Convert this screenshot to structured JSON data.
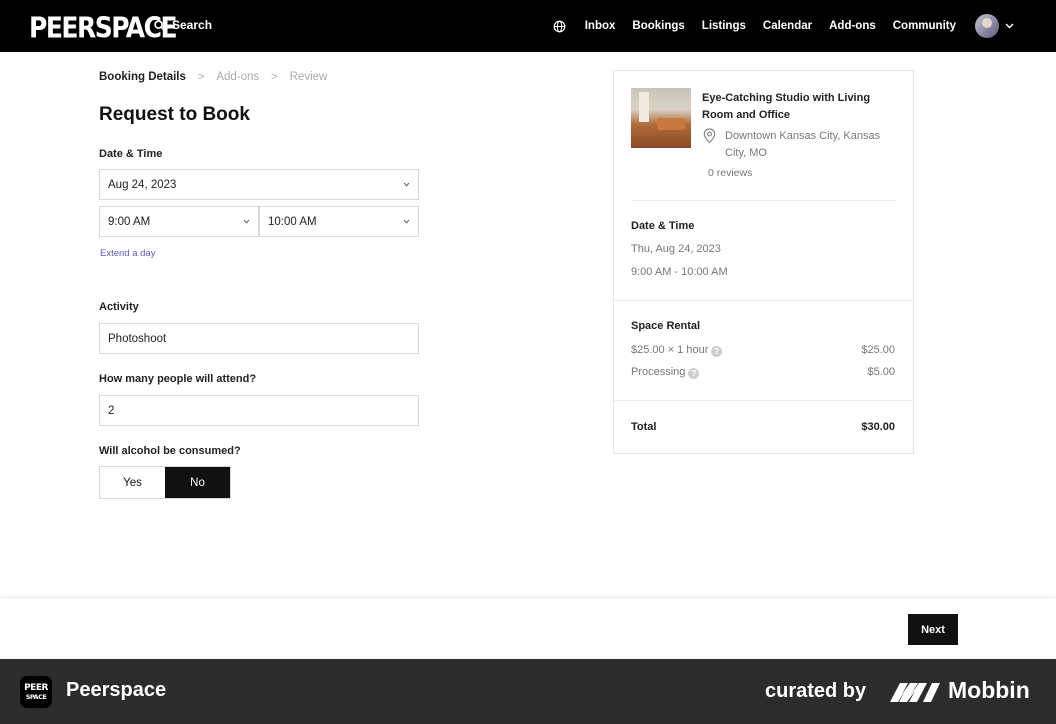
{
  "nav": {
    "logo": "PEERSPACE",
    "search_label": "Search",
    "links": [
      "Inbox",
      "Bookings",
      "Listings",
      "Calendar",
      "Add-ons",
      "Community"
    ]
  },
  "breadcrumb": {
    "steps": [
      "Booking Details",
      "Add-ons",
      "Review"
    ],
    "separator": ">"
  },
  "form": {
    "title": "Request to Book",
    "date_time_label": "Date & Time",
    "date_value": "Aug 24, 2023",
    "start_time": "9:00 AM",
    "end_time": "10:00 AM",
    "extend_link": "Extend a day",
    "activity_label": "Activity",
    "activity_value": "Photoshoot",
    "attendees_label": "How many people will attend?",
    "attendees_value": "2",
    "alcohol_label": "Will alcohol be consumed?",
    "alcohol_yes": "Yes",
    "alcohol_no": "No",
    "alcohol_selected": "No"
  },
  "summary": {
    "listing_title": "Eye-Catching Studio with Living Room and Office",
    "location": "Downtown Kansas City, Kansas City, MO",
    "reviews": "0 reviews",
    "date_time_heading": "Date & Time",
    "date": "Thu, Aug 24, 2023",
    "time_range": "9:00 AM - 10:00 AM",
    "rental_heading": "Space Rental",
    "rate_label": "$25.00 × 1 hour",
    "rate_amount": "$25.00",
    "processing_label": "Processing",
    "processing_amount": "$5.00",
    "total_label": "Total",
    "total_amount": "$30.00",
    "info_glyph": "?"
  },
  "footer": {
    "next_label": "Next"
  },
  "banner": {
    "app_icon_top": "PEER",
    "app_icon_bottom": "SPACE",
    "app_name": "Peerspace",
    "curated_by": "curated by",
    "brand": "Mobbin"
  },
  "colors": {
    "nav_bg": "#000000",
    "accent_link": "#5a5cc4",
    "banner_bg": "#2c2c2c",
    "selected_toggle": "#111111"
  }
}
